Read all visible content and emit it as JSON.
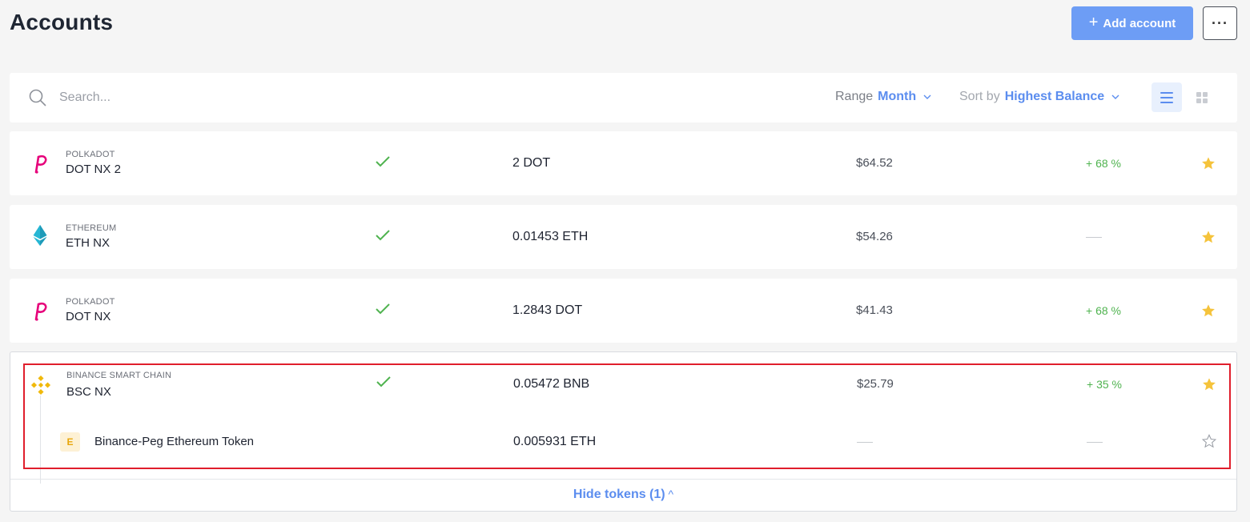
{
  "header": {
    "title": "Accounts",
    "add_button_label": "Add account",
    "more_button_label": "···"
  },
  "toolbar": {
    "search_placeholder": "Search...",
    "range_label": "Range",
    "range_value": "Month",
    "sort_label": "Sort by",
    "sort_value": "Highest Balance",
    "active_view": "list"
  },
  "accounts": [
    {
      "network": "POLKADOT",
      "name": "DOT NX 2",
      "synced": true,
      "amount": "2 DOT",
      "fiat": "$64.52",
      "change": "+ 68 %",
      "starred": true,
      "icon": "polkadot-icon"
    },
    {
      "network": "ETHEREUM",
      "name": "ETH NX",
      "synced": true,
      "amount": "0.01453 ETH",
      "fiat": "$54.26",
      "change": "",
      "starred": true,
      "icon": "ethereum-icon"
    },
    {
      "network": "POLKADOT",
      "name": "DOT NX",
      "synced": true,
      "amount": "1.2843 DOT",
      "fiat": "$41.43",
      "change": "+ 68 %",
      "starred": true,
      "icon": "polkadot-icon"
    },
    {
      "network": "BINANCE SMART CHAIN",
      "name": "BSC NX",
      "synced": true,
      "amount": "0.05472 BNB",
      "fiat": "$25.79",
      "change": "+ 35 %",
      "starred": true,
      "icon": "binance-icon",
      "tokens": [
        {
          "badge": "E",
          "name": "Binance-Peg Ethereum Token",
          "amount": "0.005931 ETH",
          "fiat": "",
          "change": "",
          "starred": false
        }
      ],
      "hide_tokens_label": "Hide tokens (1)"
    }
  ],
  "colors": {
    "accent": "#6d9df5",
    "link": "#5b8def",
    "positive": "#4fb34f",
    "star": "#f5c33b",
    "polkadot": "#e6007a",
    "binance": "#f0b90b",
    "highlight": "#e01e2c"
  }
}
